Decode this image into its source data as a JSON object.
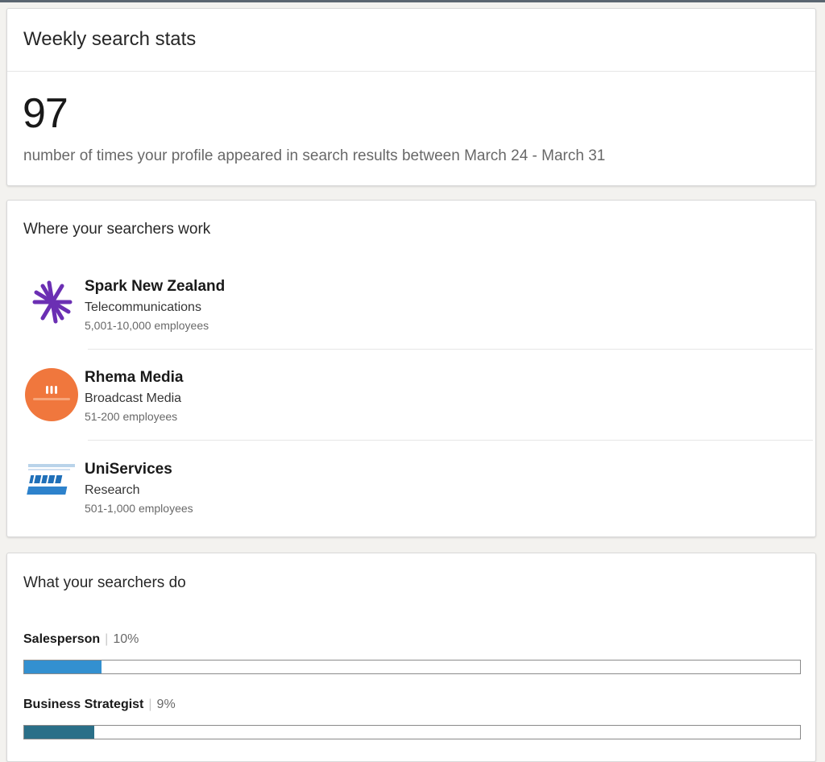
{
  "weekly_stats": {
    "title": "Weekly search stats",
    "count": "97",
    "description": "number of times your profile appeared in search results between March 24 - March 31"
  },
  "companies": {
    "title": "Where your searchers work",
    "items": [
      {
        "name": "Spark New Zealand",
        "industry": "Telecommunications",
        "size": "5,001-10,000 employees",
        "logo_icon": "spark-star-logo",
        "logo_color": "#6b2fb3"
      },
      {
        "name": "Rhema Media",
        "industry": "Broadcast Media",
        "size": "51-200 employees",
        "logo_icon": "rhema-circle-logo",
        "logo_color": "#f0773d"
      },
      {
        "name": "UniServices",
        "industry": "Research",
        "size": "501-1,000 employees",
        "logo_icon": "uniservices-ideas-logo",
        "logo_color": "#1f6fb8"
      }
    ]
  },
  "roles": {
    "title": "What your searchers do",
    "items": [
      {
        "name": "Salesperson",
        "percent_label": "10%",
        "fraction": 0.1,
        "color": "#3390d0"
      },
      {
        "name": "Business Strategist",
        "percent_label": "9%",
        "fraction": 0.09,
        "color": "#2a6f88"
      }
    ]
  }
}
